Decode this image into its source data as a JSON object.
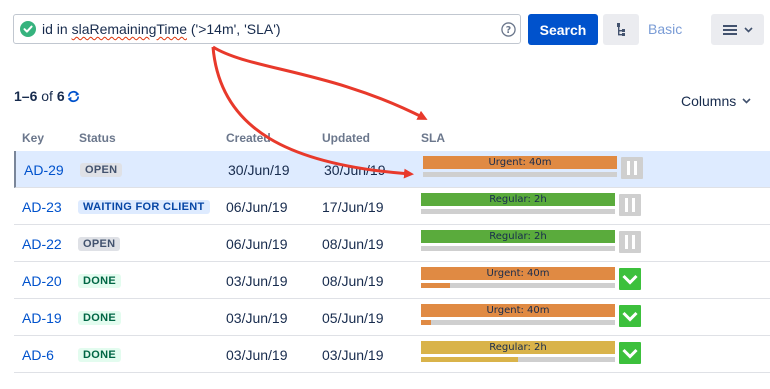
{
  "search": {
    "query_prefix": "id in ",
    "query_function": "slaRemainingTime",
    "query_suffix": " ('>14m', 'SLA')",
    "search_label": "Search",
    "basic_label": "Basic"
  },
  "results": {
    "range": "1–6",
    "of_label": " of ",
    "total": "6",
    "columns_label": "Columns"
  },
  "table": {
    "headers": {
      "key": "Key",
      "status": "Status",
      "created": "Created",
      "updated": "Updated",
      "sla": "SLA"
    },
    "rows": [
      {
        "key": "AD-29",
        "status": "OPEN",
        "created": "30/Jun/19",
        "updated": "30/Jun/19",
        "sla_label": "Urgent: 40m",
        "sla_color": "#e08a43",
        "progress": 0,
        "indicator": "pause"
      },
      {
        "key": "AD-23",
        "status": "WAITING FOR CLIENT",
        "created": "06/Jun/19",
        "updated": "17/Jun/19",
        "sla_label": "Regular: 2h",
        "sla_color": "#5aab3c",
        "progress": 0,
        "indicator": "pause"
      },
      {
        "key": "AD-22",
        "status": "OPEN",
        "created": "06/Jun/19",
        "updated": "08/Jun/19",
        "sla_label": "Regular: 2h",
        "sla_color": "#5aab3c",
        "progress": 0,
        "indicator": "pause"
      },
      {
        "key": "AD-20",
        "status": "DONE",
        "created": "03/Jun/19",
        "updated": "08/Jun/19",
        "sla_label": "Urgent: 40m",
        "sla_color": "#e08a43",
        "progress": 0.15,
        "indicator": "done"
      },
      {
        "key": "AD-19",
        "status": "DONE",
        "created": "03/Jun/19",
        "updated": "05/Jun/19",
        "sla_label": "Urgent: 40m",
        "sla_color": "#e08a43",
        "progress": 0.05,
        "indicator": "done"
      },
      {
        "key": "AD-6",
        "status": "DONE",
        "created": "03/Jun/19",
        "updated": "03/Jun/19",
        "sla_label": "Regular: 2h",
        "sla_color": "#d9b34a",
        "progress": 0.5,
        "indicator": "done"
      }
    ]
  },
  "colors": {
    "accent": "#0052cc",
    "annotation_arrow": "#e8392b"
  }
}
